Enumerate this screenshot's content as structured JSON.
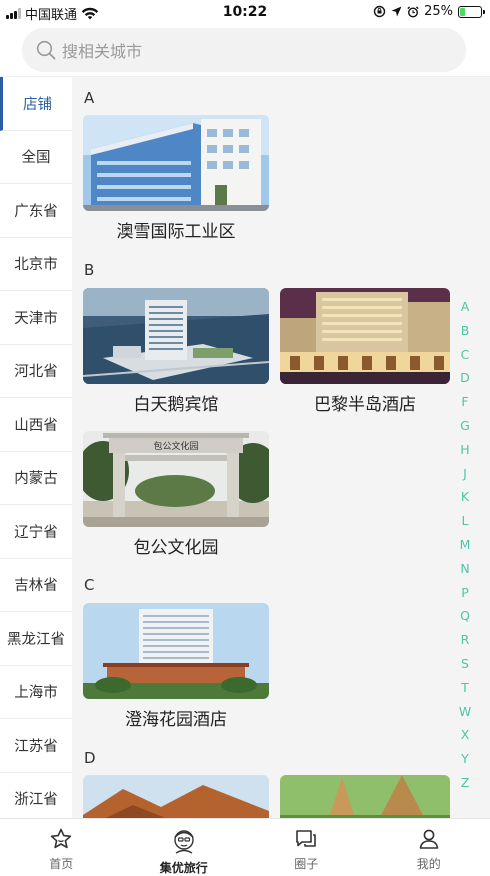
{
  "status_bar": {
    "carrier": "中国联通",
    "time": "10:22",
    "battery": "25%"
  },
  "search": {
    "placeholder": "搜相关城市"
  },
  "left_nav": {
    "items": [
      {
        "label": "店铺"
      },
      {
        "label": "全国"
      },
      {
        "label": "广东省"
      },
      {
        "label": "北京市"
      },
      {
        "label": "天津市"
      },
      {
        "label": "河北省"
      },
      {
        "label": "山西省"
      },
      {
        "label": "内蒙古"
      },
      {
        "label": "辽宁省"
      },
      {
        "label": "吉林省"
      },
      {
        "label": "黑龙江省"
      },
      {
        "label": "上海市"
      },
      {
        "label": "江苏省"
      },
      {
        "label": "浙江省"
      }
    ]
  },
  "sections": [
    {
      "letter": "A",
      "items": [
        {
          "name": "澳雪国际工业区"
        }
      ]
    },
    {
      "letter": "B",
      "items": [
        {
          "name": "白天鹅宾馆"
        },
        {
          "name": "巴黎半岛酒店"
        },
        {
          "name": "包公文化园"
        }
      ]
    },
    {
      "letter": "C",
      "items": [
        {
          "name": "澄海花园酒店"
        }
      ]
    },
    {
      "letter": "D",
      "items": []
    }
  ],
  "alphabet": [
    "A",
    "B",
    "C",
    "D",
    "F",
    "G",
    "H",
    "J",
    "K",
    "L",
    "M",
    "N",
    "P",
    "Q",
    "R",
    "S",
    "T",
    "W",
    "X",
    "Y",
    "Z"
  ],
  "gate_inscription": "包公文化园",
  "tabs": [
    {
      "label": "首页",
      "icon": "star-icon"
    },
    {
      "label": "集优旅行",
      "icon": "traveler-avatar-icon"
    },
    {
      "label": "圈子",
      "icon": "chat-bubble-icon"
    },
    {
      "label": "我的",
      "icon": "user-icon"
    }
  ],
  "colors": {
    "accent": "#2a5fa8",
    "alphabet": "#4fc4a8",
    "battery": "#4cd964"
  }
}
